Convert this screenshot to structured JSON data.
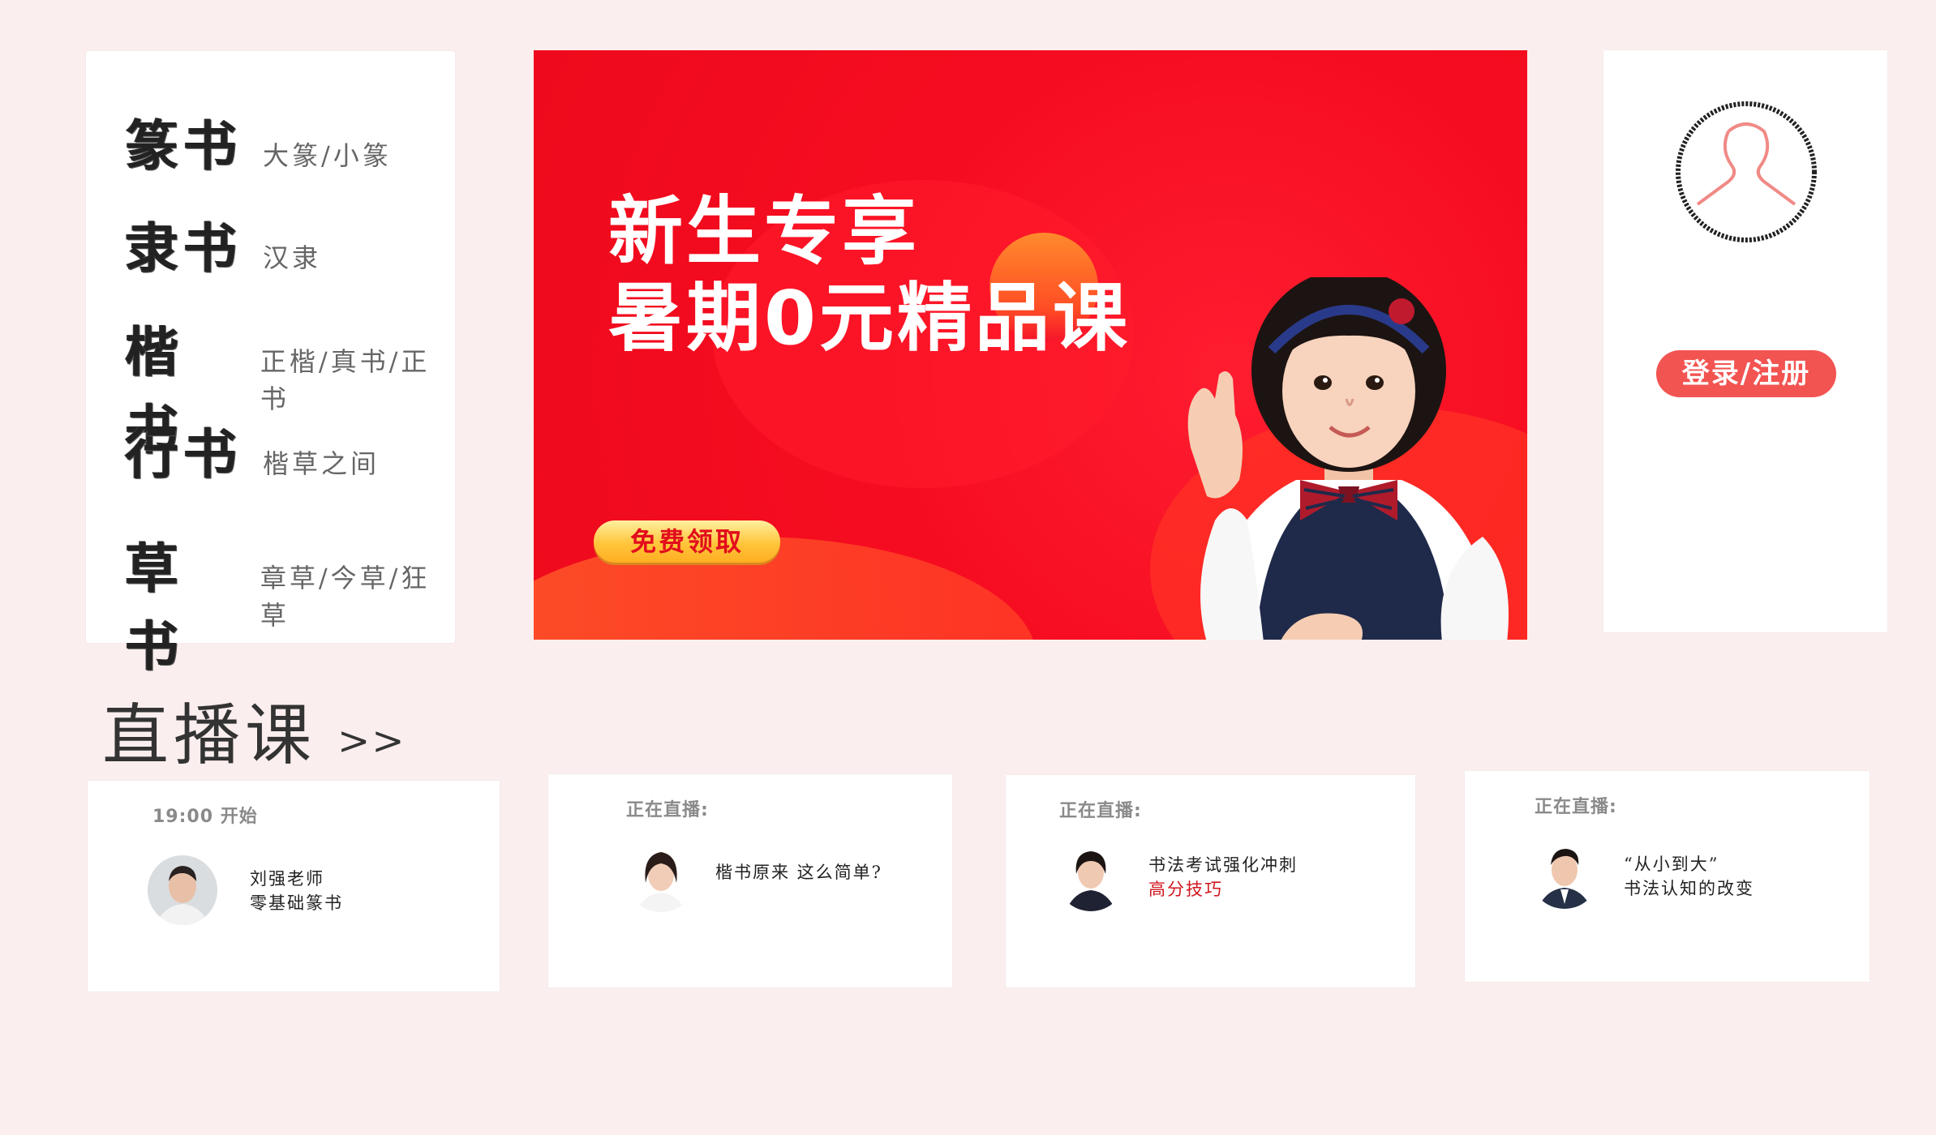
{
  "categories": [
    {
      "name": "篆书",
      "sub": "大篆/小篆"
    },
    {
      "name": "隶书",
      "sub": "汉隶"
    },
    {
      "name": "楷书",
      "sub": "正楷/真书/正书"
    },
    {
      "name": "行书",
      "sub": "楷草之间"
    },
    {
      "name": "草书",
      "sub": "章草/今草/狂草"
    }
  ],
  "banner": {
    "title_line1": "新生专享",
    "title_line2": "暑期0元精品课",
    "button": "免费领取"
  },
  "login": {
    "button": "登录/注册",
    "avatar_icon": "user-icon"
  },
  "live_section": {
    "title": "直播课",
    "arrow": ">>"
  },
  "live_classes": [
    {
      "status": "19:00 开始",
      "line1": "刘强老师",
      "line2": "零基础篆书"
    },
    {
      "status": "正在直播:",
      "line1": "楷书原来 这么简单?",
      "line2": ""
    },
    {
      "status": "正在直播:",
      "line1": "书法考试强化冲刺",
      "line2": "高分技巧"
    },
    {
      "status": "正在直播:",
      "line1": "“从小到大”",
      "line2": "书法认知的改变"
    }
  ],
  "colors": {
    "page_bg": "#fbeeee",
    "banner_red": "#f60c20",
    "login_button": "#f25451",
    "highlight_red": "#d2161e"
  }
}
